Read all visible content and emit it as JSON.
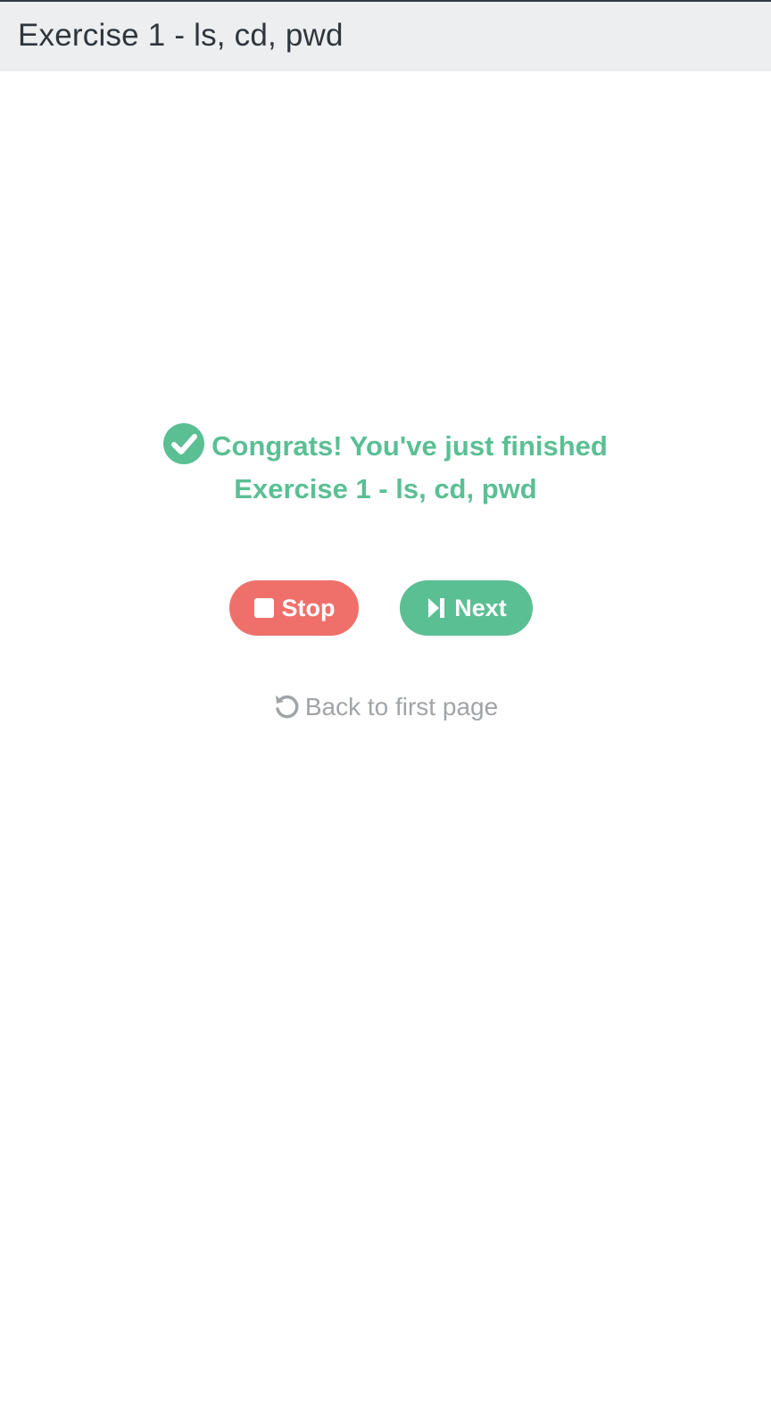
{
  "header": {
    "title": "Exercise 1 - ls, cd, pwd"
  },
  "completion": {
    "message_line1": "Congrats! You've just finished",
    "message_line2": "Exercise 1 - ls, cd, pwd",
    "icon": "check-circle-icon"
  },
  "actions": {
    "stop_label": "Stop",
    "stop_icon": "stop-icon",
    "next_label": "Next",
    "next_icon": "step-forward-icon",
    "back_label": "Back to first page",
    "back_icon": "undo-icon"
  },
  "colors": {
    "success": "#5bbf94",
    "danger": "#ef706b",
    "muted": "#a1a4a7",
    "header_bg": "#eceeef"
  }
}
